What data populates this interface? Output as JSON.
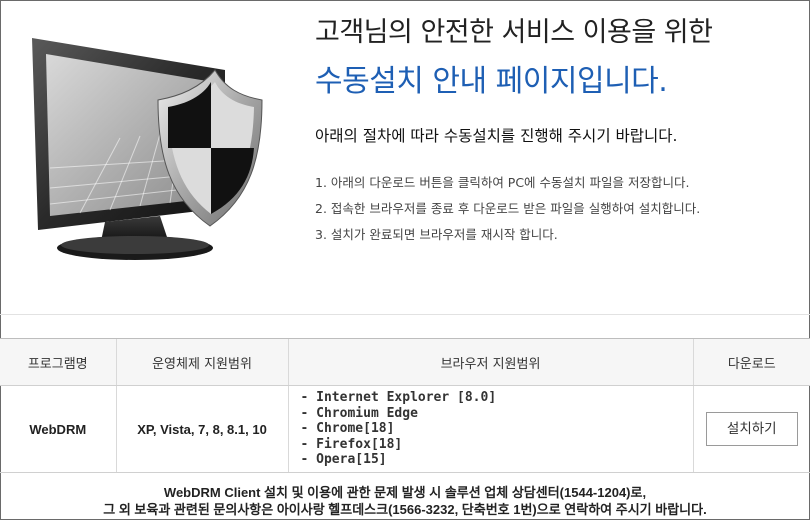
{
  "hero": {
    "title_line1": "고객님의 안전한 서비스 이용을 위한",
    "title_line2": "수동설치 안내 페이지입니다.",
    "intro": "아래의 절차에 따라 수동설치를 진행해 주시기 바랍니다.",
    "steps": [
      "1. 아래의 다운로드 버튼을 클릭하여 PC에 수동설치 파일을 저장합니다.",
      "2. 접속한 브라우저를 종료 후 다운로드 받은 파일을 실행하여 설치합니다.",
      "3. 설치가 완료되면 브라우저를 재시작 합니다."
    ],
    "illustration_icon": "monitor-shield-icon"
  },
  "table": {
    "headers": [
      "프로그램명",
      "운영체제 지원범위",
      "브라우저 지원범위",
      "다운로드"
    ],
    "row": {
      "program": "WebDRM",
      "os": "XP, Vista, 7, 8, 8.1, 10",
      "browsers": [
        "- Internet Explorer [8.0]",
        "- Chromium Edge",
        "- Chrome[18]",
        "- Firefox[18]",
        "- Opera[15]"
      ],
      "install_label": "설치하기"
    }
  },
  "footer": {
    "line1": "WebDRM Client 설치 및 이용에 관한 문제 발생 시 솔루션 업체 상담센터(1544-1204)로,",
    "line2": "그 외 보육과 관련된 문의사항은 아이사랑 헬프데스크(1566-3232, 단축번호 1번)으로 연락하여 주시기 바랍니다."
  },
  "colors": {
    "accent": "#1e5fb4",
    "text": "#222222",
    "header_bg": "#f6f6f6"
  }
}
